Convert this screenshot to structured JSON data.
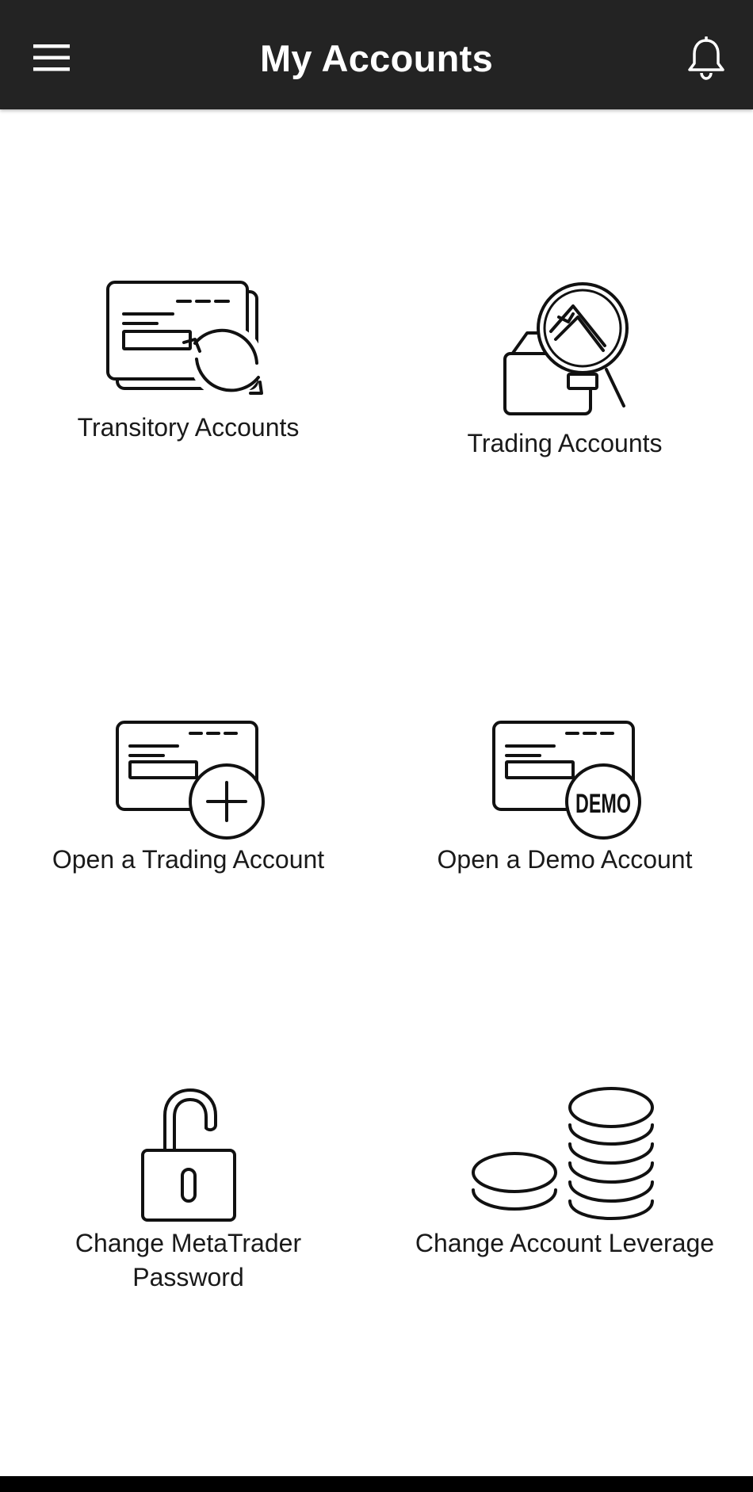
{
  "header": {
    "title": "My Accounts",
    "menu_icon": "hamburger-menu-icon",
    "notification_icon": "bell-icon"
  },
  "tiles": [
    {
      "label": "Transitory Accounts",
      "icon": "cards-exchange-icon"
    },
    {
      "label": "Trading Accounts",
      "icon": "wallet-search-icon"
    },
    {
      "label": "Open a Trading Account",
      "icon": "card-plus-icon"
    },
    {
      "label": "Open a Demo Account",
      "icon": "card-demo-icon",
      "icon_text": "DEMO"
    },
    {
      "label": "Change MetaTrader Password",
      "icon": "unlocked-padlock-icon"
    },
    {
      "label": "Change Account Leverage",
      "icon": "coin-stacks-icon"
    }
  ],
  "colors": {
    "header_bg": "#232323",
    "header_text": "#ffffff",
    "icon_stroke": "#111111",
    "label_text": "#1a1a1a",
    "background": "#ffffff"
  }
}
